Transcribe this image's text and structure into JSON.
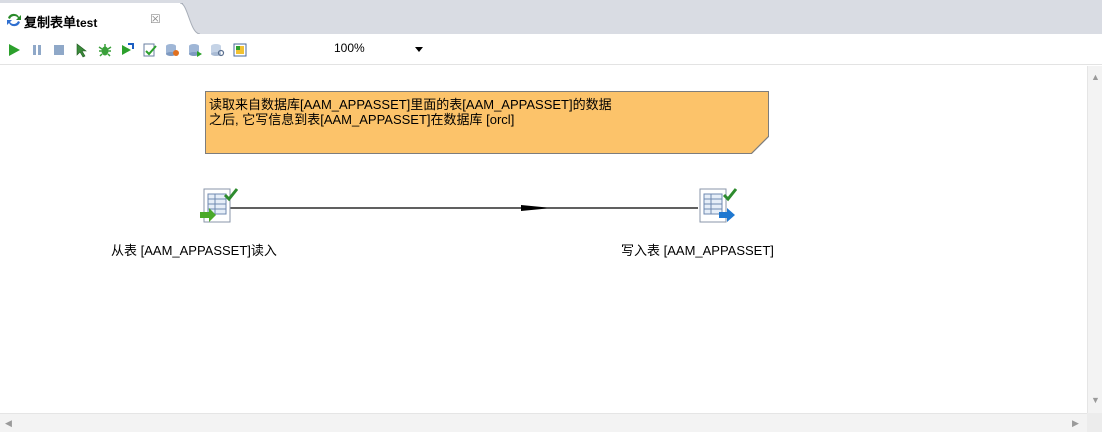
{
  "tab": {
    "title_cn": "复制表单",
    "title_suffix": "test",
    "close_glyph": "☒"
  },
  "toolbar": {
    "icons": [
      "run-icon",
      "pause-icon",
      "stop-icon",
      "preview-icon",
      "debug-icon",
      "replay-icon",
      "verify-icon",
      "impact-icon",
      "sql-icon",
      "explore-db-icon",
      "show-results-icon"
    ],
    "zoom": "100%"
  },
  "note": {
    "line1": "读取来自数据库[AAM_APPASSET]里面的表[AAM_APPASSET]的数据",
    "line2": "之后, 它写信息到表[AAM_APPASSET]在数据库 [orcl]"
  },
  "steps": {
    "input_label": "从表 [AAM_APPASSET]读入",
    "output_label": "写入表 [AAM_APPASSET]"
  },
  "colors": {
    "note_bg": "#fcc36a",
    "tab_strip": "#d9dce3",
    "checkmark": "#2e8b2e",
    "run_green": "#2ca02c"
  }
}
